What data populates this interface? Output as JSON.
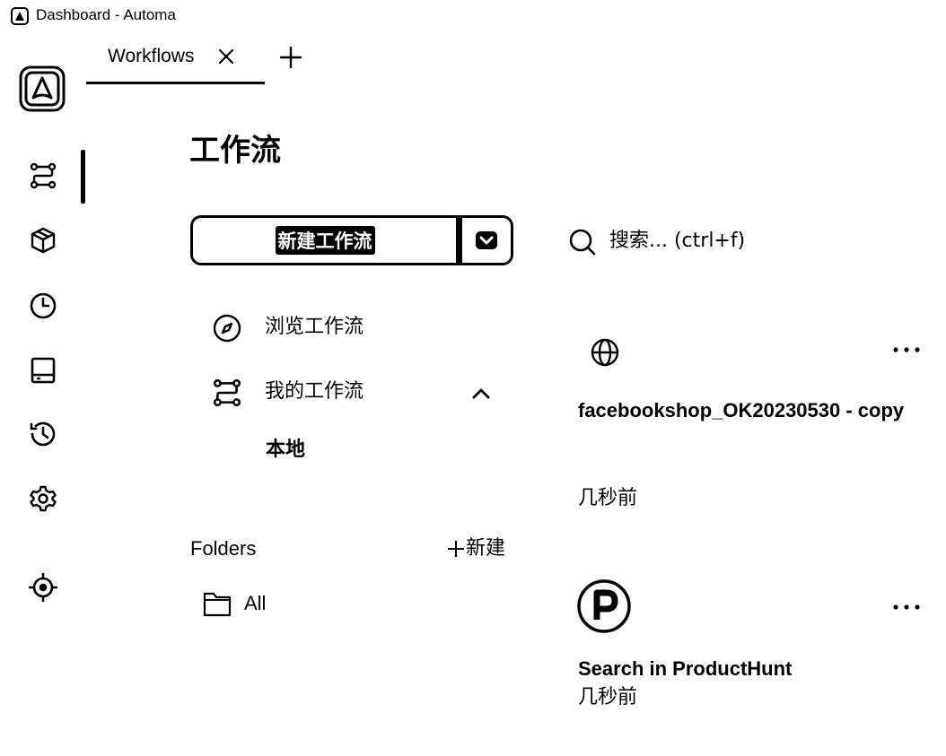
{
  "window": {
    "title": "Dashboard - Automa"
  },
  "tabs": [
    {
      "label": "Workflows"
    }
  ],
  "page": {
    "title": "工作流"
  },
  "actions": {
    "new_workflow_label": "新建工作流"
  },
  "nav": {
    "browse_label": "浏览工作流",
    "my_workflows_label": "我的工作流",
    "local_label": "本地"
  },
  "folders": {
    "title": "Folders",
    "new_label": "新建",
    "items": [
      {
        "label": "All"
      }
    ]
  },
  "search": {
    "placeholder": "搜索... (ctrl+f)"
  },
  "workflows": [
    {
      "name": "facebookshop_OK20230530 - copy",
      "time": "几秒前",
      "icon": "globe-icon"
    },
    {
      "name": "Search in ProductHunt",
      "time": "几秒前",
      "icon": "producthunt-icon"
    }
  ],
  "sidebar": {
    "icons": [
      "workflow-icon",
      "package-icon",
      "clock-icon",
      "storage-icon",
      "history-icon",
      "gear-icon",
      "crosshair-icon"
    ],
    "active": "workflow-icon"
  }
}
